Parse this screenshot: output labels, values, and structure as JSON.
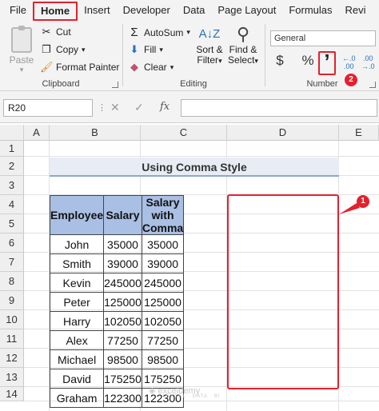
{
  "menu": {
    "tabs": [
      "File",
      "Home",
      "Insert",
      "Developer",
      "Data",
      "Page Layout",
      "Formulas",
      "Revi"
    ],
    "active_tab": "Home"
  },
  "ribbon": {
    "clipboard": {
      "label": "Clipboard",
      "paste": "Paste",
      "cut": "Cut",
      "copy": "Copy",
      "format_painter": "Format Painter"
    },
    "editing": {
      "label": "Editing",
      "autosum": "AutoSum",
      "fill": "Fill",
      "clear": "Clear",
      "sort_filter_line1": "Sort &",
      "sort_filter_line2": "Filter",
      "find_select_line1": "Find &",
      "find_select_line2": "Select"
    },
    "number": {
      "label": "Number",
      "format": "General",
      "currency": "$",
      "percent": "%",
      "comma": "’",
      "badge": "2",
      "increase_decimal_top": "←.0",
      "increase_decimal_bottom": ".00",
      "decrease_decimal_top": ".00",
      "decrease_decimal_bottom": "→.0"
    }
  },
  "formula_bar": {
    "name_box": "R20",
    "cancel": "✕",
    "enter": "✓",
    "fx": "fx",
    "formula": ""
  },
  "sheet": {
    "columns": [
      "A",
      "B",
      "C",
      "D",
      "E"
    ],
    "rows": [
      "1",
      "2",
      "3",
      "4",
      "5",
      "6",
      "7",
      "8",
      "9",
      "10",
      "11",
      "12",
      "13",
      "14"
    ],
    "title": "Using Comma Style",
    "table": {
      "headers": [
        "Employee",
        "Salary",
        "Salary with Comma"
      ],
      "rows": [
        [
          "John",
          "35000",
          "35000"
        ],
        [
          "Smith",
          "39000",
          "39000"
        ],
        [
          "Kevin",
          "245000",
          "245000"
        ],
        [
          "Peter",
          "125000",
          "125000"
        ],
        [
          "Harry",
          "102050",
          "102050"
        ],
        [
          "Alex",
          "77250",
          "77250"
        ],
        [
          "Michael",
          "98500",
          "98500"
        ],
        [
          "David",
          "175250",
          "175250"
        ],
        [
          "Graham",
          "122300",
          "122300"
        ]
      ]
    },
    "badge": "1"
  },
  "watermark": {
    "name": "exceldemy",
    "tagline": "EXCEL · DATA · BI"
  },
  "colors": {
    "accent_red": "#e5202e",
    "header_fill": "#a9bfe3",
    "title_fill": "#e8ecf4"
  }
}
